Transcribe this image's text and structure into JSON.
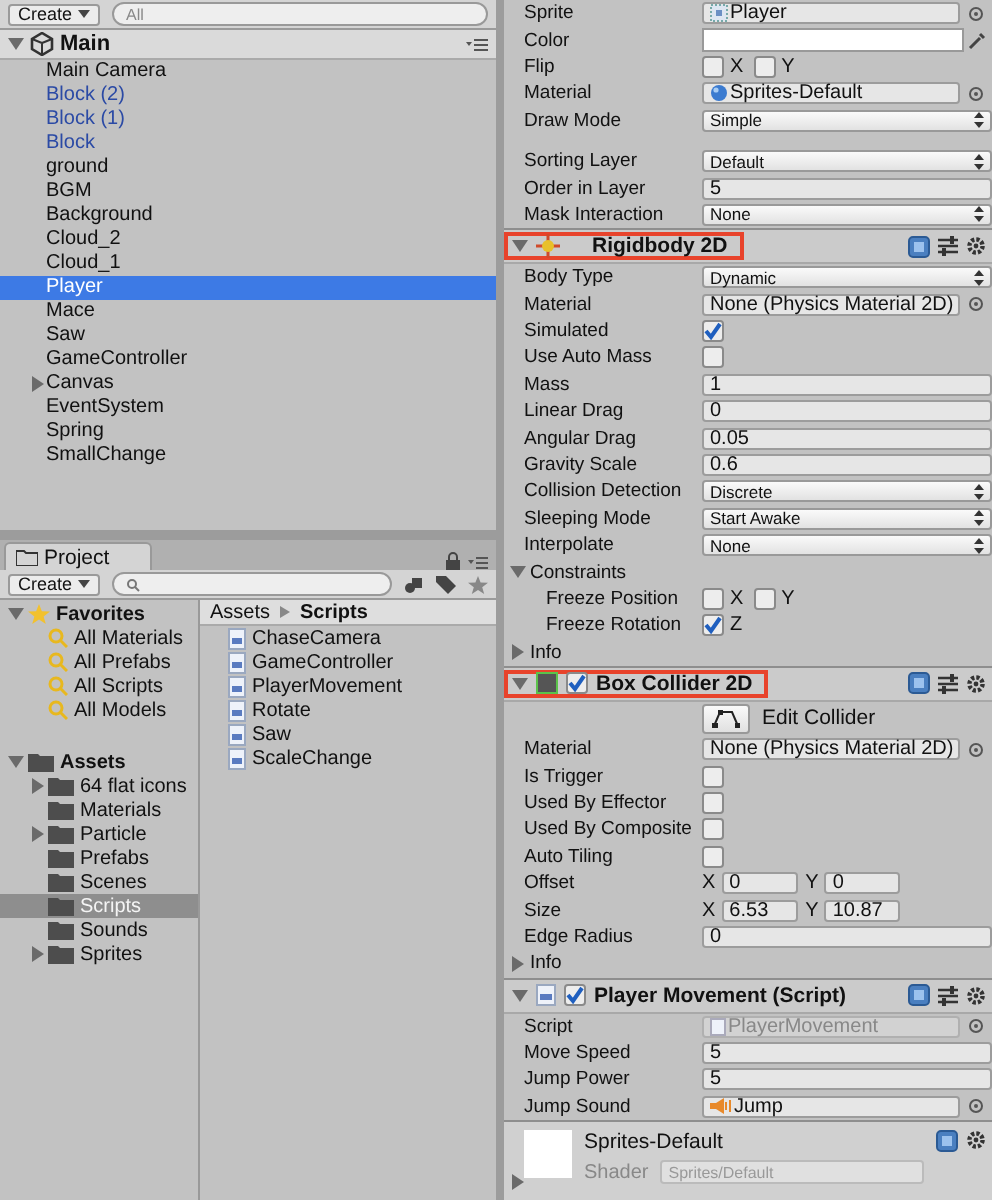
{
  "hierarchy": {
    "create_label": "Create",
    "search_placeholder": "All",
    "scene": {
      "name": "Main",
      "expanded": true
    },
    "items": [
      {
        "label": "Main Camera",
        "prefab": false,
        "has_children": false,
        "selected": false
      },
      {
        "label": "Block (2)",
        "prefab": true,
        "has_children": false,
        "selected": false
      },
      {
        "label": "Block (1)",
        "prefab": true,
        "has_children": false,
        "selected": false
      },
      {
        "label": "Block",
        "prefab": true,
        "has_children": false,
        "selected": false
      },
      {
        "label": "ground",
        "prefab": false,
        "has_children": false,
        "selected": false
      },
      {
        "label": "BGM",
        "prefab": false,
        "has_children": false,
        "selected": false
      },
      {
        "label": "Background",
        "prefab": false,
        "has_children": false,
        "selected": false
      },
      {
        "label": "Cloud_2",
        "prefab": false,
        "has_children": false,
        "selected": false
      },
      {
        "label": "Cloud_1",
        "prefab": false,
        "has_children": false,
        "selected": false
      },
      {
        "label": "Player",
        "prefab": false,
        "has_children": false,
        "selected": true
      },
      {
        "label": "Mace",
        "prefab": false,
        "has_children": false,
        "selected": false
      },
      {
        "label": "Saw",
        "prefab": false,
        "has_children": false,
        "selected": false
      },
      {
        "label": "GameController",
        "prefab": false,
        "has_children": false,
        "selected": false
      },
      {
        "label": "Canvas",
        "prefab": false,
        "has_children": true,
        "expanded": false,
        "selected": false
      },
      {
        "label": "EventSystem",
        "prefab": false,
        "has_children": false,
        "selected": false
      },
      {
        "label": "Spring",
        "prefab": false,
        "has_children": false,
        "selected": false
      },
      {
        "label": "SmallChange",
        "prefab": false,
        "has_children": false,
        "selected": false
      }
    ]
  },
  "project": {
    "tab": "Project",
    "create_label": "Create",
    "favorites": {
      "label": "Favorites",
      "expanded": true,
      "items": [
        "All Materials",
        "All Prefabs",
        "All Scripts",
        "All Models"
      ]
    },
    "assets": {
      "label": "Assets",
      "expanded": true,
      "folders": [
        {
          "label": "64 flat icons",
          "has_children": true,
          "selected": false
        },
        {
          "label": "Materials",
          "has_children": false,
          "selected": false
        },
        {
          "label": "Particle",
          "has_children": true,
          "selected": false
        },
        {
          "label": "Prefabs",
          "has_children": false,
          "selected": false
        },
        {
          "label": "Scenes",
          "has_children": false,
          "selected": false
        },
        {
          "label": "Scripts",
          "has_children": false,
          "selected": true
        },
        {
          "label": "Sounds",
          "has_children": false,
          "selected": false
        },
        {
          "label": "Sprites",
          "has_children": true,
          "selected": false
        }
      ]
    },
    "breadcrumb": [
      "Assets",
      "Scripts"
    ],
    "files": [
      "ChaseCamera",
      "GameController",
      "PlayerMovement",
      "Rotate",
      "Saw",
      "ScaleChange"
    ]
  },
  "inspector": {
    "components": [
      {
        "kind": "fields",
        "rows": [
          {
            "kind": "object",
            "label": "Sprite",
            "value": "Player",
            "disabled": false
          },
          {
            "kind": "color",
            "label": "Color",
            "color": "#ffffff"
          },
          {
            "kind": "axis_toggles",
            "label": "Flip",
            "toggles": [
              {
                "axis": "X",
                "checked": false
              },
              {
                "axis": "Y",
                "checked": false
              }
            ]
          },
          {
            "kind": "object",
            "label": "Material",
            "value": "Sprites-Default",
            "disabled": false
          },
          {
            "kind": "dropdown",
            "label": "Draw Mode",
            "value": "Simple"
          },
          {
            "kind": "spacer"
          },
          {
            "kind": "dropdown",
            "label": "Sorting Layer",
            "value": "Default"
          },
          {
            "kind": "text",
            "label": "Order in Layer",
            "value": "5"
          },
          {
            "kind": "dropdown",
            "label": "Mask Interaction",
            "value": "None"
          }
        ]
      },
      {
        "kind": "component",
        "title": "Rigidbody 2D",
        "expanded": true,
        "has_toggle": false,
        "highlighted": true,
        "rows": [
          {
            "kind": "dropdown",
            "label": "Body Type",
            "value": "Dynamic"
          },
          {
            "kind": "object",
            "label": "Material",
            "value": "None (Physics Material 2D)",
            "disabled": false
          },
          {
            "kind": "checkbox",
            "label": "Simulated",
            "checked": true
          },
          {
            "kind": "checkbox",
            "label": "Use Auto Mass",
            "checked": false
          },
          {
            "kind": "text",
            "label": "Mass",
            "value": "1"
          },
          {
            "kind": "text",
            "label": "Linear Drag",
            "value": "0"
          },
          {
            "kind": "text",
            "label": "Angular Drag",
            "value": "0.05"
          },
          {
            "kind": "text",
            "label": "Gravity Scale",
            "value": "0.6"
          },
          {
            "kind": "dropdown",
            "label": "Collision Detection",
            "value": "Discrete"
          },
          {
            "kind": "dropdown",
            "label": "Sleeping Mode",
            "value": "Start Awake"
          },
          {
            "kind": "dropdown",
            "label": "Interpolate",
            "value": "None"
          },
          {
            "kind": "foldout",
            "label": "Constraints",
            "expanded": true,
            "children": [
              {
                "kind": "axis_toggles",
                "label": "Freeze Position",
                "toggles": [
                  {
                    "axis": "X",
                    "checked": false
                  },
                  {
                    "axis": "Y",
                    "checked": false
                  }
                ]
              },
              {
                "kind": "axis_toggles",
                "label": "Freeze Rotation",
                "toggles": [
                  {
                    "axis": "Z",
                    "checked": true
                  }
                ]
              }
            ]
          },
          {
            "kind": "foldout",
            "label": "Info",
            "expanded": false,
            "children": []
          }
        ]
      },
      {
        "kind": "component",
        "title": "Box Collider 2D",
        "expanded": true,
        "has_toggle": true,
        "enabled": true,
        "highlighted": true,
        "rows": [
          {
            "kind": "edit_button",
            "label": "Edit Collider"
          },
          {
            "kind": "object",
            "label": "Material",
            "value": "None (Physics Material 2D)",
            "disabled": false
          },
          {
            "kind": "checkbox",
            "label": "Is Trigger",
            "checked": false
          },
          {
            "kind": "checkbox",
            "label": "Used By Effector",
            "checked": false
          },
          {
            "kind": "checkbox",
            "label": "Used By Composite",
            "checked": false
          },
          {
            "kind": "checkbox",
            "label": "Auto Tiling",
            "checked": false
          },
          {
            "kind": "vector2",
            "label": "Offset",
            "fields": [
              {
                "axis": "X",
                "value": "0"
              },
              {
                "axis": "Y",
                "value": "0"
              }
            ]
          },
          {
            "kind": "vector2",
            "label": "Size",
            "fields": [
              {
                "axis": "X",
                "value": "6.53"
              },
              {
                "axis": "Y",
                "value": "10.87"
              }
            ]
          },
          {
            "kind": "text",
            "label": "Edge Radius",
            "value": "0"
          },
          {
            "kind": "foldout",
            "label": "Info",
            "expanded": false,
            "children": []
          }
        ]
      },
      {
        "kind": "component",
        "title": "Player Movement (Script)",
        "expanded": true,
        "has_toggle": true,
        "enabled": true,
        "highlighted": false,
        "rows": [
          {
            "kind": "object",
            "label": "Script",
            "value": "PlayerMovement",
            "disabled": true
          },
          {
            "kind": "text",
            "label": "Move Speed",
            "value": "5"
          },
          {
            "kind": "text",
            "label": "Jump Power",
            "value": "5"
          },
          {
            "kind": "object",
            "label": "Jump Sound",
            "value": "Jump",
            "disabled": false
          }
        ]
      }
    ],
    "material": {
      "name": "Sprites-Default",
      "shader_label": "Shader",
      "shader_value": "Sprites/Default",
      "expanded": false
    }
  }
}
